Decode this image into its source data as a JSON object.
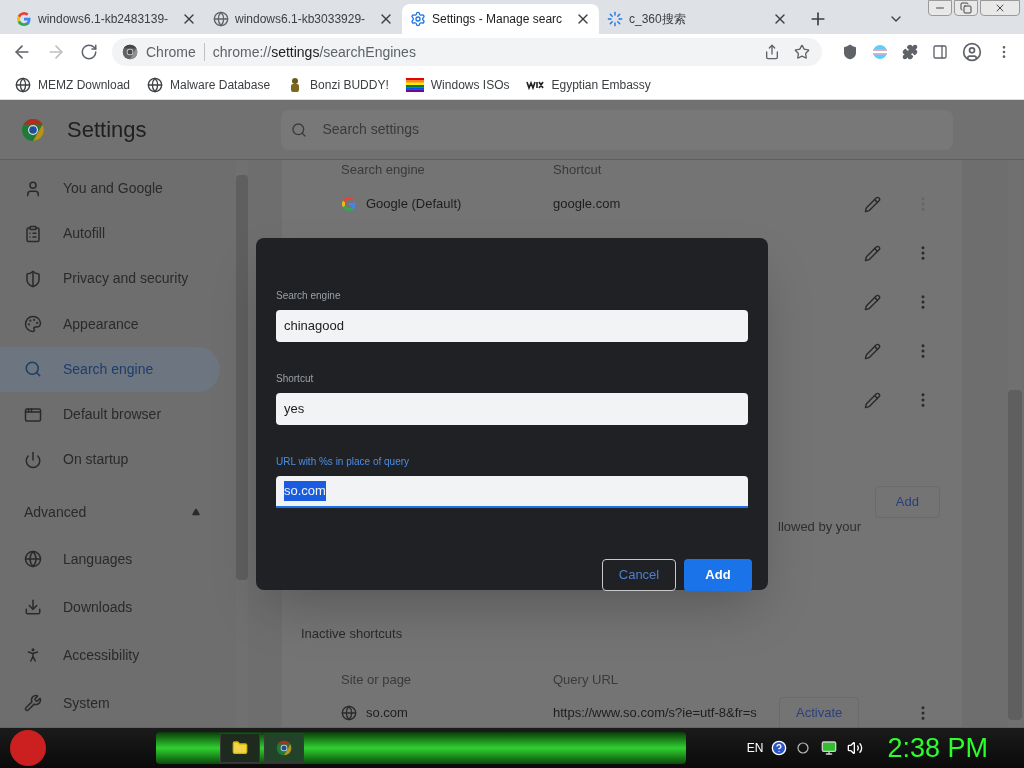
{
  "tabs": [
    {
      "title": "windows6.1-kb2483139-",
      "selected": false
    },
    {
      "title": "windows6.1-kb3033929-",
      "selected": false
    },
    {
      "title": "Settings - Manage searc",
      "selected": true
    },
    {
      "title": "c_360搜索",
      "selected": false
    }
  ],
  "address": {
    "site_label": "Chrome",
    "url_scheme": "chrome://",
    "url_host": "settings",
    "url_path": "/searchEngines"
  },
  "bookmarks": [
    {
      "label": "MEMZ Download"
    },
    {
      "label": "Malware Database"
    },
    {
      "label": "Bonzi BUDDY!"
    },
    {
      "label": "Windows ISOs"
    },
    {
      "label": "Egyptian Embassy"
    }
  ],
  "settings": {
    "title": "Settings",
    "search_placeholder": "Search settings"
  },
  "sidebar": {
    "items": [
      {
        "label": "You and Google",
        "selected": false
      },
      {
        "label": "Autofill",
        "selected": false
      },
      {
        "label": "Privacy and security",
        "selected": false
      },
      {
        "label": "Appearance",
        "selected": false
      },
      {
        "label": "Search engine",
        "selected": true
      },
      {
        "label": "Default browser",
        "selected": false
      },
      {
        "label": "On startup",
        "selected": false
      }
    ],
    "advanced": {
      "label": "Advanced",
      "expanded": true,
      "items": [
        {
          "label": "Languages"
        },
        {
          "label": "Downloads"
        },
        {
          "label": "Accessibility"
        },
        {
          "label": "System"
        }
      ]
    }
  },
  "engines": {
    "columns": [
      "Search engine",
      "Shortcut"
    ],
    "rows": [
      {
        "name": "Google (Default)",
        "shortcut": "google.com",
        "menu_disabled": true
      },
      {
        "menu_disabled": false
      },
      {
        "menu_disabled": false
      },
      {
        "menu_disabled": false
      },
      {
        "menu_disabled": false
      }
    ]
  },
  "site_search": {
    "add_button": "Add",
    "description": "llowed by your"
  },
  "inactive": {
    "title": "Inactive shortcuts",
    "columns": [
      "Site or page",
      "Query URL"
    ],
    "rows": [
      {
        "name": "so.com",
        "url": "https://www.so.com/s?ie=utf-8&fr=s",
        "action": "Activate"
      }
    ]
  },
  "dialog": {
    "fields": [
      {
        "label": "Search engine",
        "value": "chinagood",
        "focused": false
      },
      {
        "label": "Shortcut",
        "value": "yes",
        "focused": false
      },
      {
        "label": "URL with %s in place of query",
        "value": "so.com",
        "focused": true
      }
    ],
    "cancel": "Cancel",
    "confirm": "Add"
  },
  "taskbar": {
    "language": "EN",
    "clock": "2:38 PM"
  }
}
